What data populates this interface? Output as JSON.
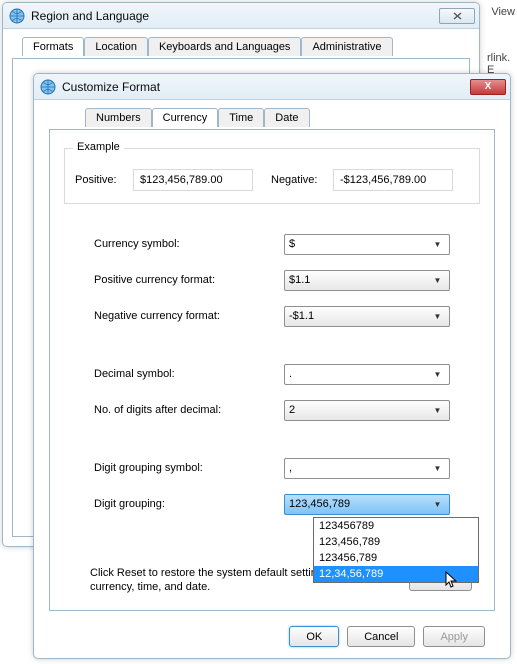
{
  "background": {
    "view": "View",
    "rlink": "rlink. E"
  },
  "region_window": {
    "title": "Region and Language",
    "tabs": [
      "Formats",
      "Location",
      "Keyboards and Languages",
      "Administrative"
    ]
  },
  "custom_window": {
    "title": "Customize Format",
    "close_x": "X",
    "tabs": [
      "Numbers",
      "Currency",
      "Time",
      "Date"
    ],
    "example": {
      "legend": "Example",
      "positive_label": "Positive:",
      "positive_value": "$123,456,789.00",
      "negative_label": "Negative:",
      "negative_value": "-$123,456,789.00"
    },
    "fields": {
      "currency_symbol": {
        "label": "Currency symbol:",
        "value": "$"
      },
      "positive_format": {
        "label": "Positive currency format:",
        "value": "$1.1"
      },
      "negative_format": {
        "label": "Negative currency format:",
        "value": "-$1.1"
      },
      "decimal_symbol": {
        "label": "Decimal symbol:",
        "value": "."
      },
      "digits_after_decimal": {
        "label": "No. of digits after decimal:",
        "value": "2"
      },
      "grouping_symbol": {
        "label": "Digit grouping symbol:",
        "value": ","
      },
      "digit_grouping": {
        "label": "Digit grouping:",
        "value": "123,456,789"
      }
    },
    "digit_grouping_options": [
      "123456789",
      "123,456,789",
      "123456,789",
      "12,34,56,789"
    ],
    "reset": {
      "text": "Click Reset to restore the system default settings for numbers, currency, time, and date.",
      "button": "Reset"
    },
    "buttons": {
      "ok": "OK",
      "cancel": "Cancel",
      "apply": "Apply"
    }
  }
}
